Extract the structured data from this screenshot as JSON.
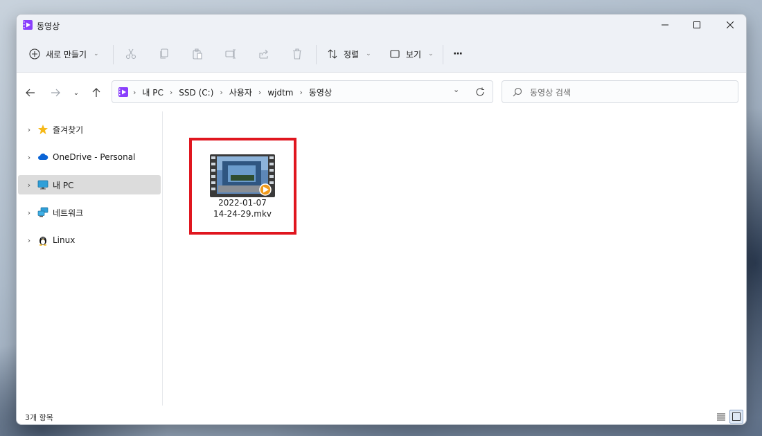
{
  "window": {
    "title": "동영상",
    "accent": "#8a3ffc"
  },
  "toolbar": {
    "new_label": "새로 만들기",
    "sort_label": "정렬",
    "view_label": "보기",
    "more_label": "···"
  },
  "address": {
    "crumbs": [
      "내 PC",
      "SSD (C:)",
      "사용자",
      "wjdtm",
      "동영상"
    ]
  },
  "search": {
    "placeholder": "동영상 검색"
  },
  "sidebar": {
    "items": [
      {
        "label": "즐겨찾기",
        "icon": "star-icon"
      },
      {
        "label": "OneDrive - Personal",
        "icon": "cloud-icon"
      },
      {
        "label": "내 PC",
        "icon": "monitor-icon",
        "selected": true
      },
      {
        "label": "네트워크",
        "icon": "network-icon"
      },
      {
        "label": "Linux",
        "icon": "penguin-icon"
      }
    ]
  },
  "files": [
    {
      "name_line1": "2022-01-07",
      "name_line2": "14-24-29.mkv",
      "icon": "video-file-icon"
    }
  ],
  "status": {
    "item_count": "3개 항목"
  },
  "colors": {
    "highlight": "#e0161f",
    "selected_bg": "#dcdcdc"
  }
}
